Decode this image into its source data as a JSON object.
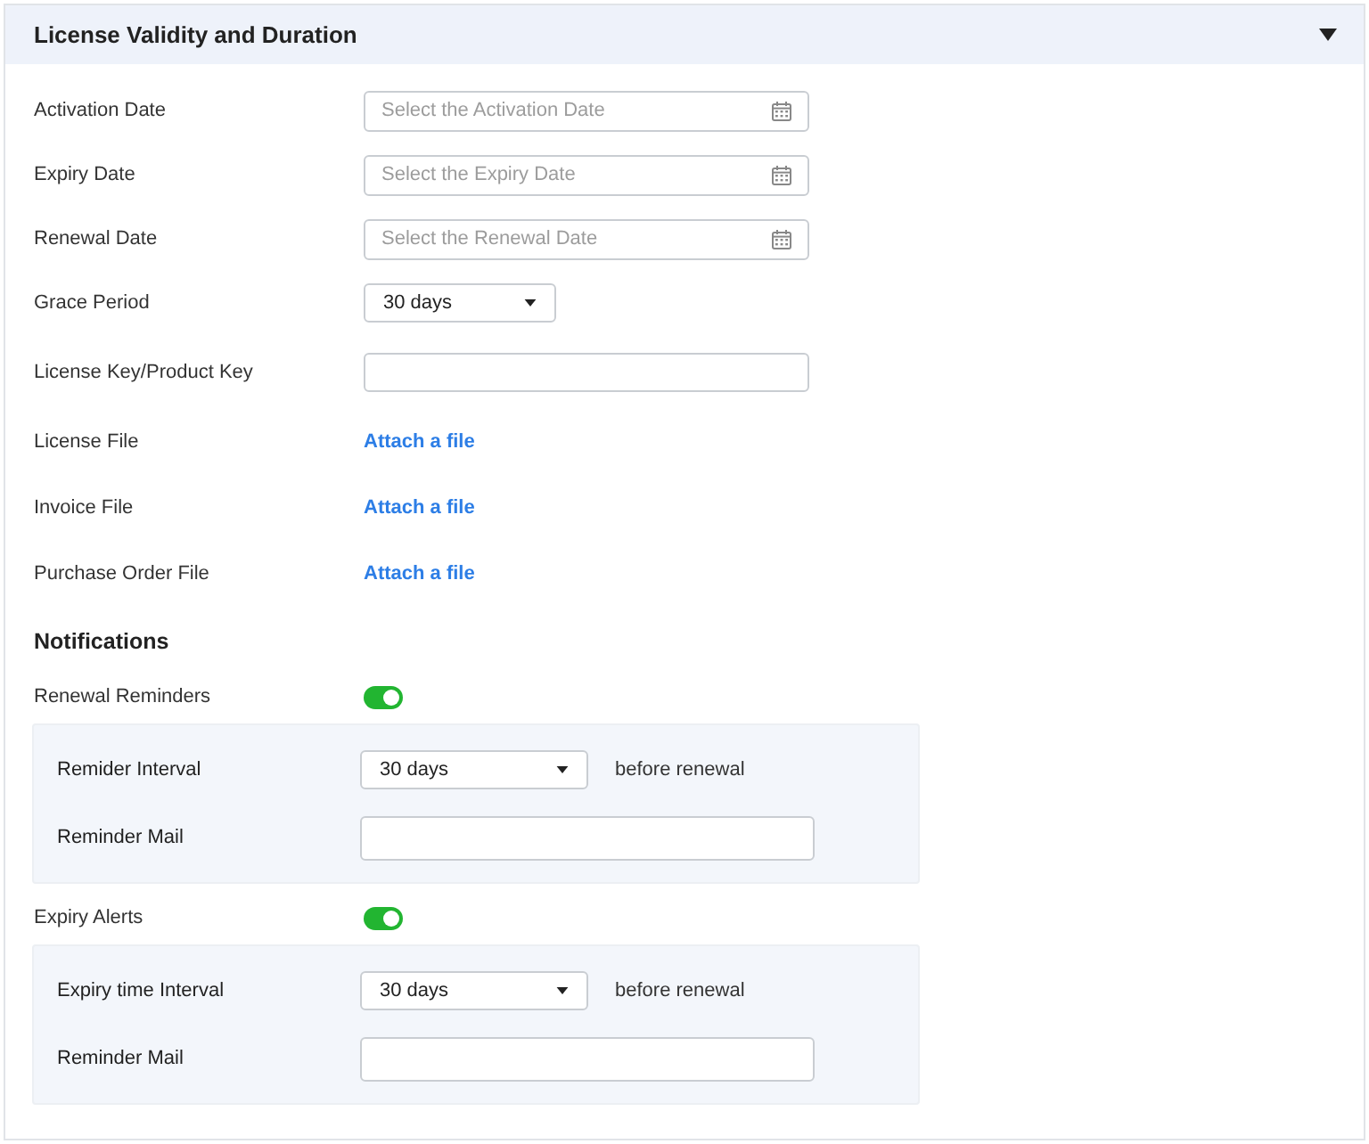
{
  "section": {
    "title": "License Validity and Duration",
    "expanded": true
  },
  "fields": [
    {
      "kind": "date",
      "label": "Activation Date",
      "placeholder": "Select the Activation Date"
    },
    {
      "kind": "date",
      "label": "Expiry Date",
      "placeholder": "Select the Expiry Date"
    },
    {
      "kind": "date",
      "label": "Renewal Date",
      "placeholder": "Select the Renewal Date"
    },
    {
      "kind": "select",
      "label": "Grace Period",
      "value": "30 days"
    },
    {
      "kind": "text",
      "label": "License Key/Product Key"
    },
    {
      "kind": "attach",
      "label": "License File",
      "link": "Attach a file"
    },
    {
      "kind": "attach",
      "label": "Invoice File",
      "link": "Attach a file"
    },
    {
      "kind": "attach",
      "label": "Purchase Order File",
      "link": "Attach a file"
    }
  ],
  "notifications": {
    "heading": "Notifications",
    "groups": [
      {
        "label": "Renewal Reminders",
        "on": true,
        "settings": [
          {
            "kind": "select",
            "label": "Remider Interval",
            "value": "30 days",
            "suffix": "before renewal"
          },
          {
            "kind": "text",
            "label": "Reminder Mail"
          }
        ]
      },
      {
        "label": "Expiry Alerts",
        "on": true,
        "settings": [
          {
            "kind": "select",
            "label": "Expiry time Interval",
            "value": "30 days",
            "suffix": "before renewal"
          },
          {
            "kind": "text",
            "label": "Reminder Mail"
          }
        ]
      }
    ]
  }
}
